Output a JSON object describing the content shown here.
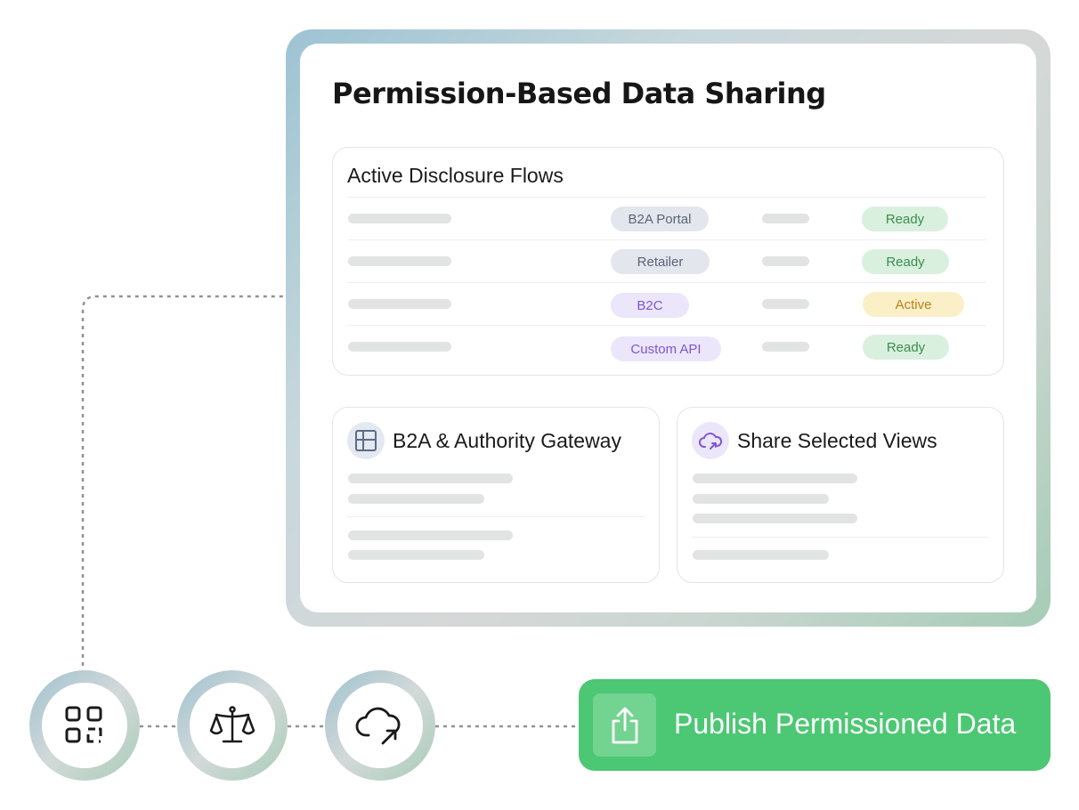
{
  "card": {
    "title": "Permission-Based Data Sharing"
  },
  "flows": {
    "title": "Active Disclosure Flows",
    "rows": [
      {
        "channel": "B2A Portal",
        "channel_tone": "grey",
        "status": "Ready",
        "status_tone": "ready"
      },
      {
        "channel": "Retailer",
        "channel_tone": "grey",
        "status": "Ready",
        "status_tone": "ready"
      },
      {
        "channel": "B2C",
        "channel_tone": "purple",
        "status": "Active",
        "status_tone": "active"
      },
      {
        "channel": "Custom API",
        "channel_tone": "purple",
        "status": "Ready",
        "status_tone": "ready"
      }
    ]
  },
  "gateway_card": {
    "title": "B2A & Authority Gateway",
    "icon": "grid-icon"
  },
  "share_card": {
    "title": "Share Selected Views",
    "icon": "cloud-share-icon"
  },
  "steps": [
    {
      "icon": "qr-code-icon"
    },
    {
      "icon": "scales-icon"
    },
    {
      "icon": "cloud-upload-icon"
    }
  ],
  "publish_button": {
    "label": "Publish Permissioned Data",
    "icon": "share-upload-icon"
  },
  "colors": {
    "accent_green": "#4cc773",
    "ready_bg": "#d9f0de",
    "ready_text": "#3c8c50",
    "active_bg": "#fbefc8",
    "active_text": "#b58316",
    "channel_grey_bg": "#e3e6ed",
    "channel_purple_bg": "#ece6fb"
  }
}
